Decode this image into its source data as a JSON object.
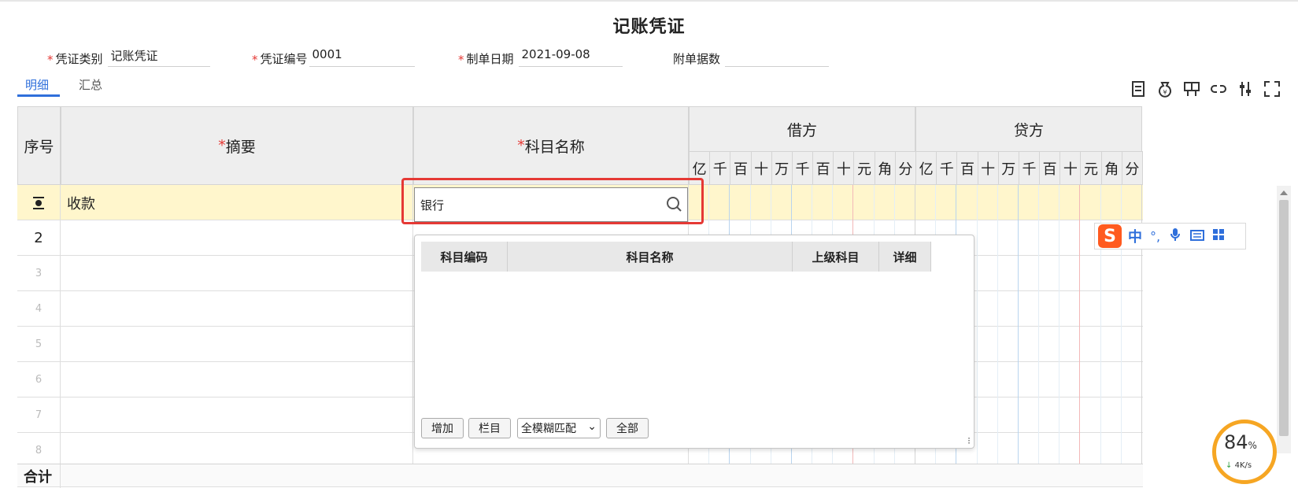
{
  "page": {
    "title": "记账凭证"
  },
  "header_fields": {
    "voucher_type": {
      "label": "凭证类别",
      "value": "记账凭证"
    },
    "voucher_no": {
      "label": "凭证编号",
      "value": "0001"
    },
    "date": {
      "label": "制单日期",
      "value": "2021-09-08"
    },
    "attachments": {
      "label": "附单据数",
      "value": ""
    }
  },
  "tabs": [
    {
      "label": "明细",
      "active": true
    },
    {
      "label": "汇总",
      "active": false
    }
  ],
  "toolbar_icons": [
    "doc-icon",
    "moneybag-icon",
    "layout-icon",
    "link-icon",
    "adjust-icon",
    "fullscreen-icon"
  ],
  "table": {
    "headers": {
      "seq": "序号",
      "summary": "摘要",
      "account": "科目名称",
      "debit": "借方",
      "credit": "贷方"
    },
    "digits": [
      "亿",
      "千",
      "百",
      "十",
      "万",
      "千",
      "百",
      "十",
      "元",
      "角",
      "分"
    ],
    "rows": [
      {
        "seq": "",
        "summary": "收款",
        "account": "银行"
      },
      {
        "seq": "2",
        "summary": "",
        "account": ""
      },
      {
        "seq": "3",
        "summary": "",
        "account": ""
      },
      {
        "seq": "4",
        "summary": "",
        "account": ""
      },
      {
        "seq": "5",
        "summary": "",
        "account": ""
      },
      {
        "seq": "6",
        "summary": "",
        "account": ""
      },
      {
        "seq": "7",
        "summary": "",
        "account": ""
      },
      {
        "seq": "8",
        "summary": "",
        "account": ""
      }
    ],
    "total_label": "合计"
  },
  "account_popup": {
    "columns": [
      "科目编码",
      "科目名称",
      "上级科目",
      "详细"
    ],
    "buttons": {
      "add": "增加",
      "columns": "栏目",
      "all": "全部"
    },
    "match_mode": "全模糊匹配"
  },
  "ime": {
    "chinese": "中",
    "punct": "°,"
  },
  "speed_widget": {
    "percent": "84",
    "unit": "%",
    "rate": "4K/s"
  },
  "colors": {
    "accent": "#2f6fdb",
    "required": "#e53935",
    "highlight_row": "#fff6cc"
  }
}
